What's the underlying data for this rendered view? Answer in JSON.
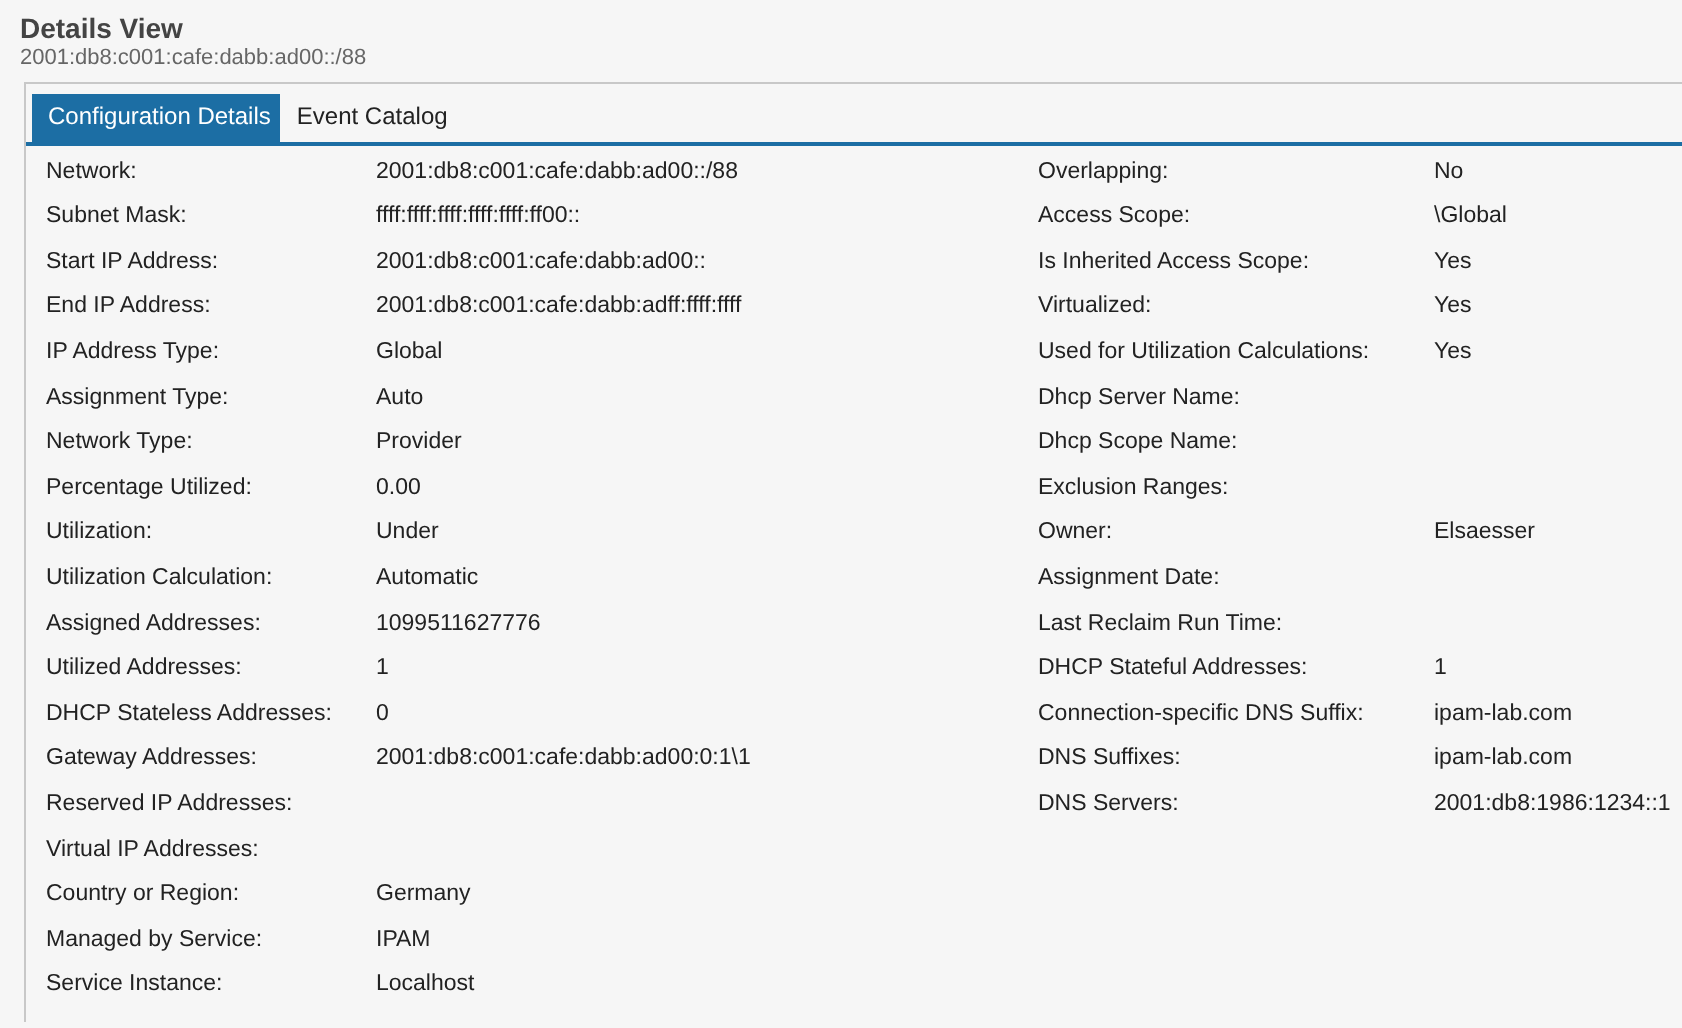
{
  "header": {
    "title": "Details View",
    "subtitle": "2001:db8:c001:cafe:dabb:ad00::/88"
  },
  "tabs": [
    {
      "label": "Configuration Details",
      "selected": true
    },
    {
      "label": "Event Catalog",
      "selected": false
    }
  ],
  "left_fields": [
    {
      "label": "Network:",
      "value": "2001:db8:c001:cafe:dabb:ad00::/88"
    },
    {
      "label": "Subnet Mask:",
      "value": "ffff:ffff:ffff:ffff:ffff:ff00::"
    },
    {
      "label": "Start IP Address:",
      "value": "2001:db8:c001:cafe:dabb:ad00::"
    },
    {
      "label": "End IP Address:",
      "value": "2001:db8:c001:cafe:dabb:adff:ffff:ffff"
    },
    {
      "label": "IP Address Type:",
      "value": "Global"
    },
    {
      "label": "Assignment Type:",
      "value": "Auto"
    },
    {
      "label": "Network Type:",
      "value": "Provider"
    },
    {
      "label": "Percentage Utilized:",
      "value": "0.00"
    },
    {
      "label": "Utilization:",
      "value": "Under"
    },
    {
      "label": "Utilization Calculation:",
      "value": "Automatic"
    },
    {
      "label": "Assigned Addresses:",
      "value": "1099511627776"
    },
    {
      "label": "Utilized Addresses:",
      "value": "1"
    },
    {
      "label": "DHCP Stateless Addresses:",
      "value": "0"
    },
    {
      "label": "Gateway Addresses:",
      "value": "2001:db8:c001:cafe:dabb:ad00:0:1\\1"
    },
    {
      "label": "Reserved IP Addresses:"
    },
    {
      "label": "Virtual IP Addresses:"
    },
    {
      "label": "Country or Region:",
      "value": "Germany"
    },
    {
      "label": "Managed by Service:",
      "value": "IPAM"
    },
    {
      "label": "Service Instance:",
      "value": "Localhost"
    }
  ],
  "right_fields": [
    {
      "label": "Overlapping:",
      "value": "No"
    },
    {
      "label": "Access Scope:",
      "value": "\\Global"
    },
    {
      "label": "Is Inherited Access Scope:",
      "value": "Yes"
    },
    {
      "label": "Virtualized:",
      "value": "Yes"
    },
    {
      "label": "Used for Utilization Calculations:",
      "value": "Yes"
    },
    {
      "label": "Dhcp Server Name:"
    },
    {
      "label": "Dhcp Scope Name:"
    },
    {
      "label": "Exclusion Ranges:"
    },
    {
      "label": "Owner:",
      "value": "Elsaesser"
    },
    {
      "label": "Assignment Date:"
    },
    {
      "label": "Last Reclaim Run Time:"
    },
    {
      "label": "DHCP Stateful Addresses:",
      "value": "1"
    },
    {
      "label": "Connection-specific DNS Suffix:",
      "value": "ipam-lab.com"
    },
    {
      "label": "DNS Suffixes:",
      "value": "ipam-lab.com"
    },
    {
      "label": "DNS Servers:",
      "value": "2001:db8:1986:1234::1"
    }
  ]
}
